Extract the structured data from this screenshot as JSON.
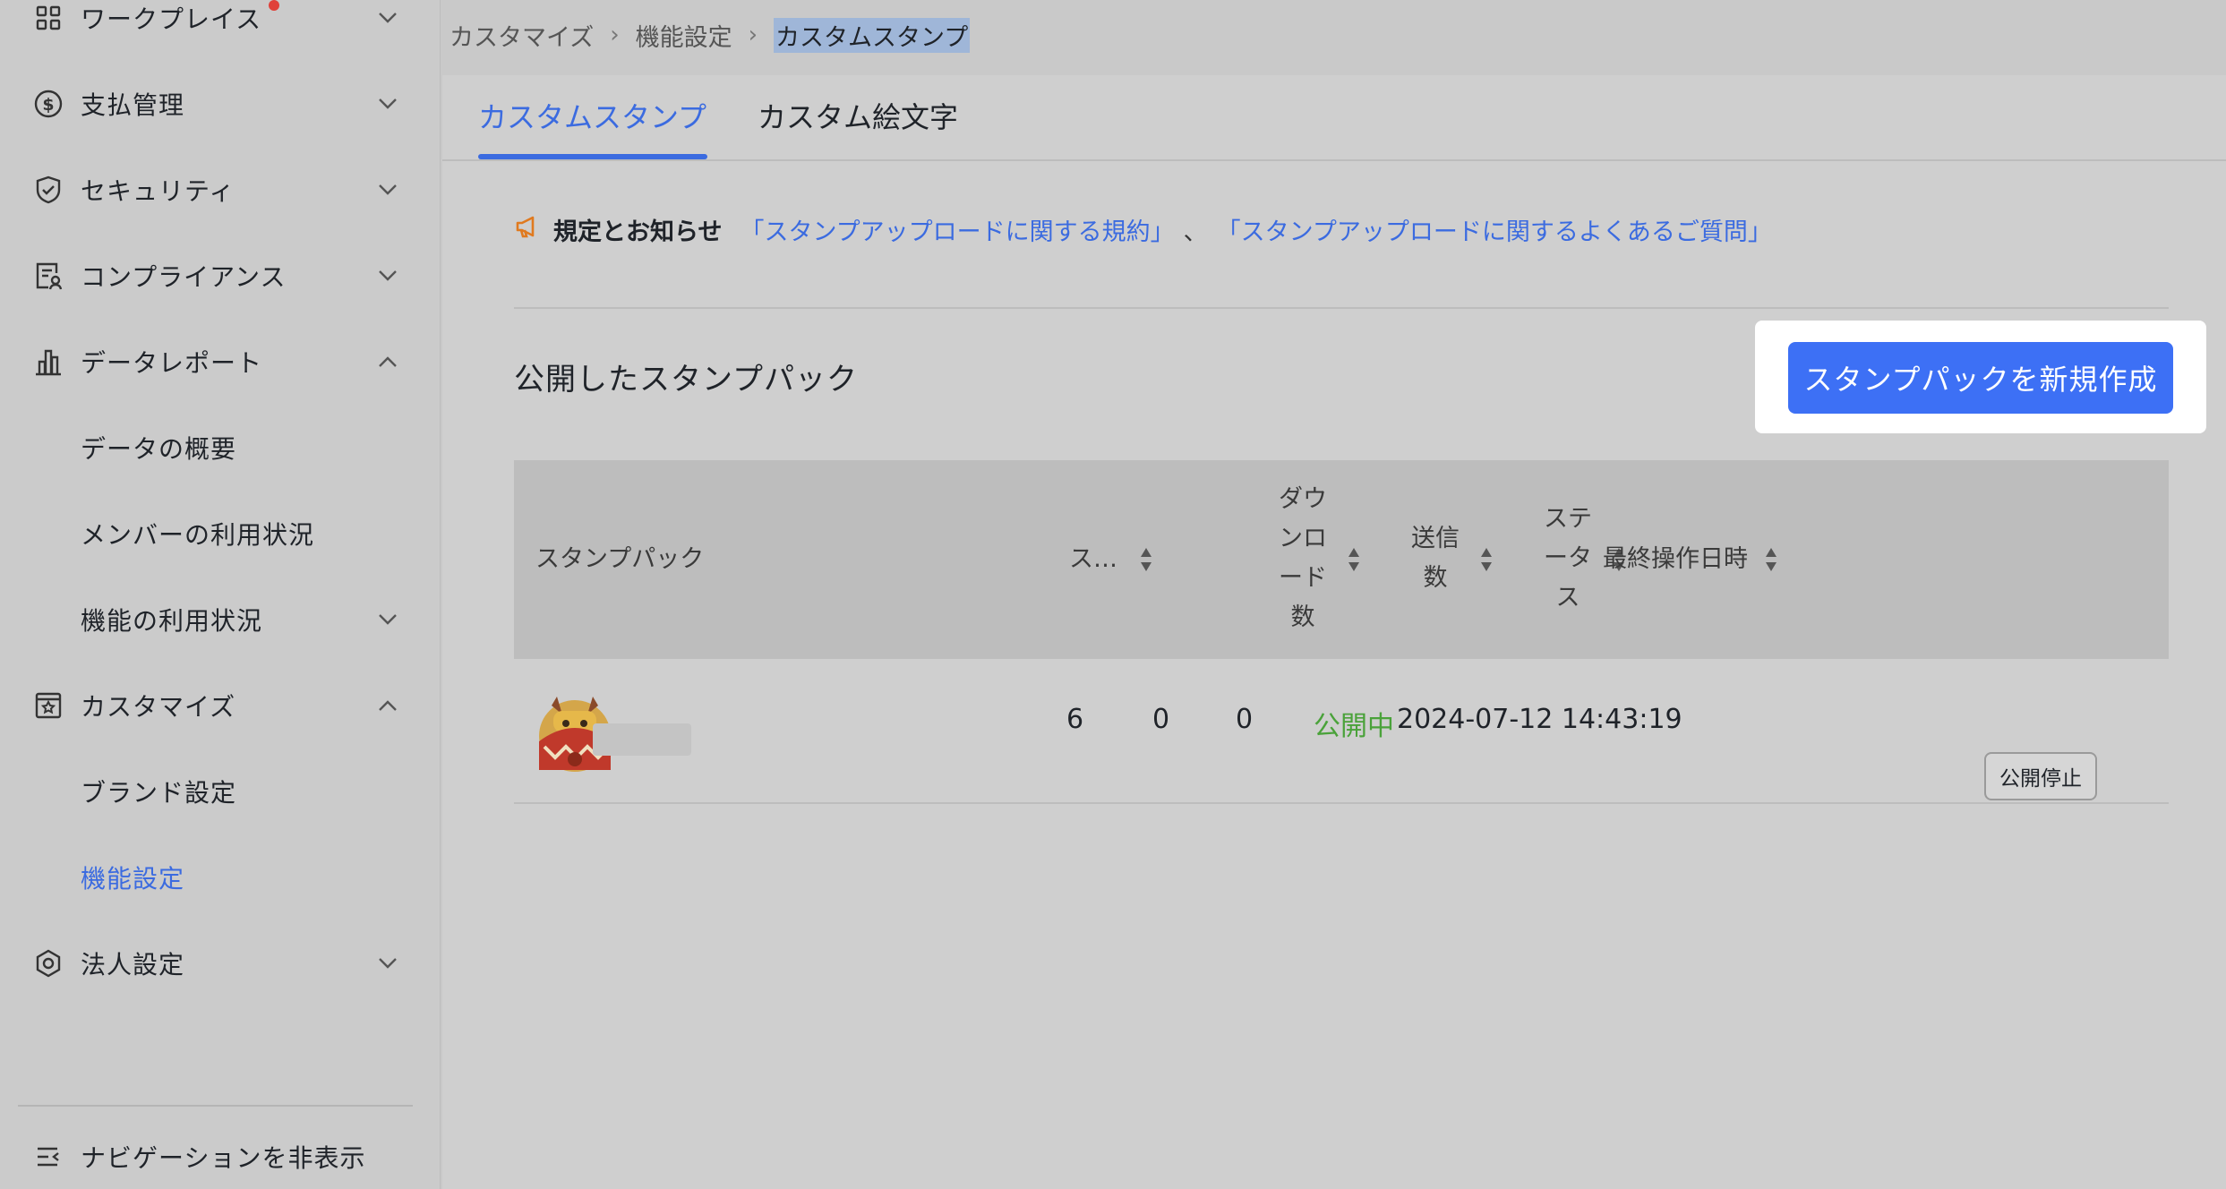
{
  "sidebar": {
    "items": [
      {
        "label": "ワークプレイス",
        "icon": "grid-icon",
        "chevron": "down"
      },
      {
        "label": "支払管理",
        "icon": "dollar-circle-icon",
        "chevron": "down"
      },
      {
        "label": "セキュリティ",
        "icon": "shield-check-icon",
        "chevron": "down"
      },
      {
        "label": "コンプライアンス",
        "icon": "document-user-icon",
        "chevron": "down"
      },
      {
        "label": "データレポート",
        "icon": "bar-chart-icon",
        "chevron": "up"
      },
      {
        "label": "データの概要"
      },
      {
        "label": "メンバーの利用状況"
      },
      {
        "label": "機能の利用状況",
        "chevron": "down"
      },
      {
        "label": "カスタマイズ",
        "icon": "star-box-icon",
        "chevron": "up"
      },
      {
        "label": "ブランド設定"
      },
      {
        "label": "機能設定",
        "active": true
      },
      {
        "label": "法人設定",
        "icon": "hexagon-gear-icon",
        "chevron": "down"
      }
    ],
    "hide_nav_label": "ナビゲーションを非表示"
  },
  "breadcrumb": [
    "カスタマイズ",
    "機能設定",
    "カスタムスタンプ"
  ],
  "tabs": [
    "カスタムスタンプ",
    "カスタム絵文字"
  ],
  "notice": {
    "title": "規定とお知らせ",
    "link1": "「スタンプアップロードに関する規約」",
    "sep": "、",
    "link2": "「スタンプアップロードに関するよくあるご質問」"
  },
  "section_title": "公開したスタンプパック",
  "create_button": "スタンプパックを新規作成",
  "table": {
    "headers": [
      "スタンプパック",
      "ス…",
      "ダウンロード数",
      "送信数",
      "ステータス",
      "最終操作日時"
    ],
    "rows": [
      {
        "count": "6",
        "downloads": "0",
        "sent": "0",
        "status": "公開中",
        "updated": "2024-07-12 14:43:19",
        "action": "公開停止"
      }
    ]
  },
  "colors": {
    "accent": "#3d70f5",
    "status_green": "#4aa23a"
  }
}
